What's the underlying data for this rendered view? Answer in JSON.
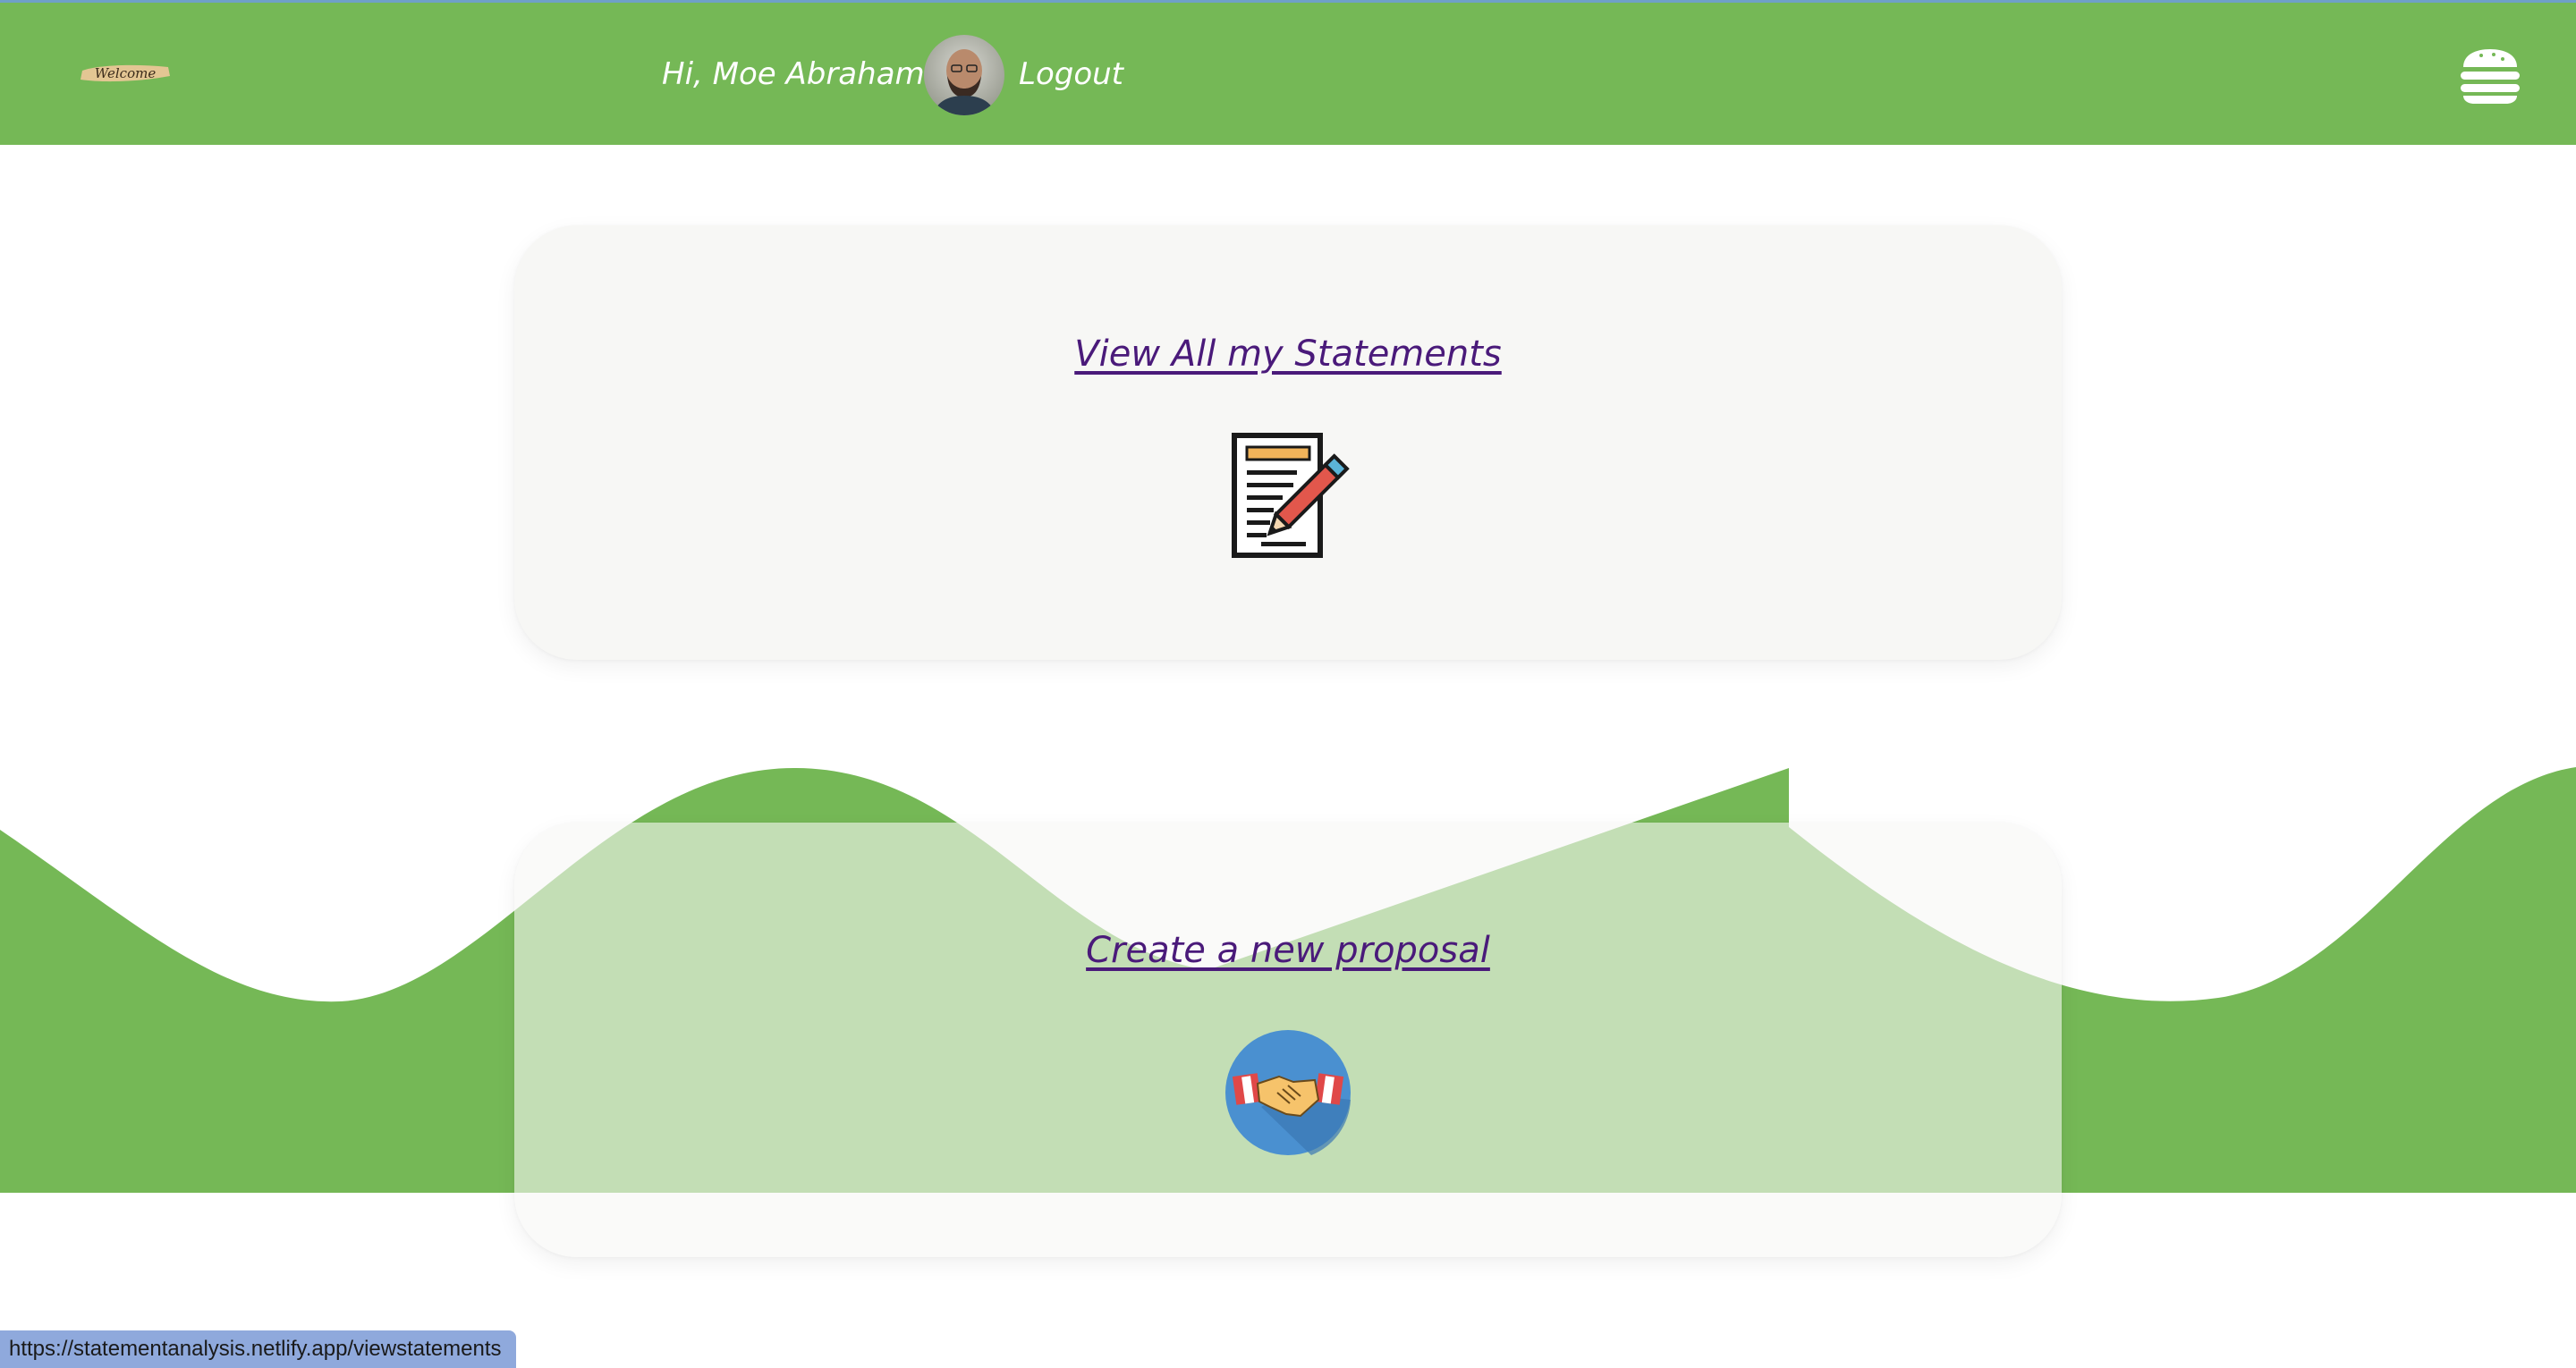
{
  "header": {
    "logo_text": "Welcome",
    "greeting": "Hi, Moe Abraham",
    "logout_label": "Logout",
    "menu_icon": "hamburger-icon"
  },
  "cards": {
    "statements": {
      "label": "View All my Statements",
      "icon": "document-edit-icon"
    },
    "proposal": {
      "label": "Create a new proposal",
      "icon": "handshake-icon"
    }
  },
  "status_bar": {
    "url": "https://statementanalysis.netlify.app/viewstatements"
  },
  "colors": {
    "header_green": "#75b856",
    "wave_green": "#75b856",
    "link_purple": "#4a1a7a",
    "status_blue": "#8fa9dc"
  }
}
